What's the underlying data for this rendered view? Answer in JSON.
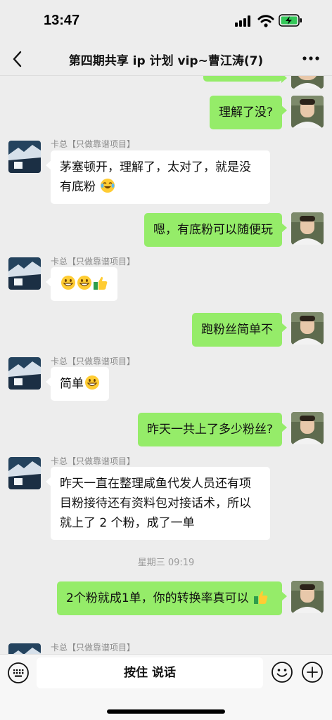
{
  "status": {
    "time": "13:47"
  },
  "nav": {
    "title": "第四期共享 ip 计划 vip~曹江涛(7)"
  },
  "messages": [
    {
      "from": "me",
      "text": "理解了没?"
    },
    {
      "from": "them",
      "sender": "卡总【只做靠谱项目】",
      "text": "茅塞顿开，理解了，太对了，就是没有底粉",
      "emoji": [
        "face-with-tears-of-joy"
      ]
    },
    {
      "from": "me",
      "text": "嗯，有底粉可以随便玩"
    },
    {
      "from": "them",
      "sender": "卡总【只做靠谱项目】",
      "text": "",
      "emoji": [
        "grinning-face",
        "grinning-face",
        "thumbs-up"
      ]
    },
    {
      "from": "me",
      "text": "跑粉丝简单不"
    },
    {
      "from": "them",
      "sender": "卡总【只做靠谱项目】",
      "text": "简单",
      "emoji": [
        "grinning-face"
      ]
    },
    {
      "from": "me",
      "text": "昨天一共上了多少粉丝?"
    },
    {
      "from": "them",
      "sender": "卡总【只做靠谱项目】",
      "text": "昨天一直在整理咸鱼代发人员还有项目粉接待还有资料包对接话术，所以就上了 2 个粉，成了一单"
    },
    {
      "divider": "星期三 09:19"
    },
    {
      "from": "me",
      "text": "2个粉就成1单，你的转换率真可以",
      "emoji": [
        "thumbs-up"
      ]
    },
    {
      "from": "them",
      "sender": "卡总【只做靠谱项目】",
      "text": ""
    }
  ],
  "input": {
    "hold_to_talk": "按住 说话"
  },
  "icons": [
    "back-icon",
    "more-icon",
    "voice-icon",
    "emoji-icon",
    "plus-icon"
  ],
  "colors": {
    "my_bubble": "#95ec69",
    "their_bubble": "#ffffff",
    "background": "#ededed"
  }
}
